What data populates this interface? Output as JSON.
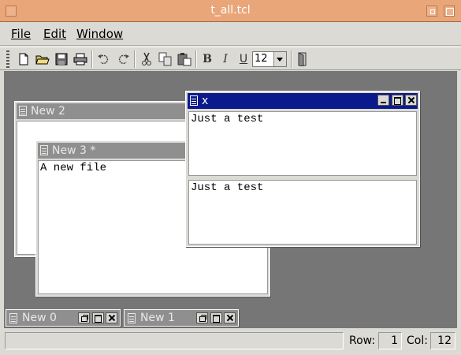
{
  "window": {
    "title": "t_all.tcl"
  },
  "menu": [
    {
      "label": "File"
    },
    {
      "label": "Edit"
    },
    {
      "label": "Window"
    }
  ],
  "toolbar": {
    "bold_label": "B",
    "italic_label": "I",
    "underline_label": "U",
    "font_size": "12"
  },
  "documents": {
    "new2": {
      "title": "New 2",
      "content": ""
    },
    "new3": {
      "title": "New 3 *",
      "content": "A new file"
    },
    "x": {
      "title": "x",
      "top_text": "Just a test",
      "bottom_text": "Just a test"
    }
  },
  "minimized": [
    {
      "title": "New 0"
    },
    {
      "title": "New 1"
    }
  ],
  "status": {
    "row_label": "Row:",
    "row_value": "1",
    "col_label": "Col:",
    "col_value": "12"
  }
}
